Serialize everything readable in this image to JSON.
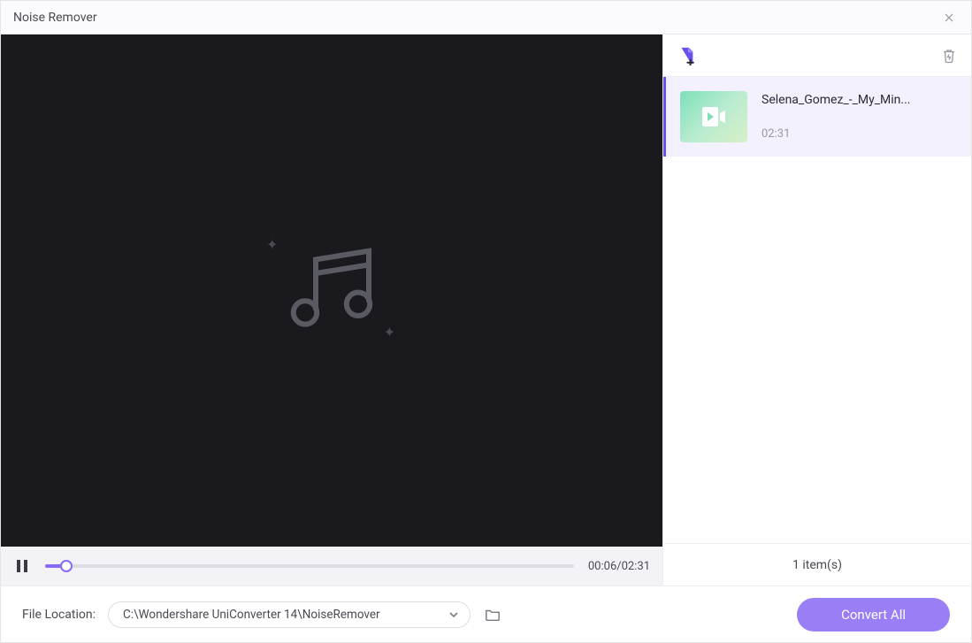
{
  "window": {
    "title": "Noise Remover"
  },
  "player": {
    "current_time": "00:06",
    "total_time": "02:31",
    "progress_percent": 4
  },
  "queue": {
    "items": [
      {
        "name": "Selena_Gomez_-_My_Min...",
        "duration": "02:31"
      }
    ],
    "count_label": "1 item(s)"
  },
  "footer": {
    "file_location_label": "File Location:",
    "file_location_value": "C:\\Wondershare UniConverter 14\\NoiseRemover",
    "convert_label": "Convert All"
  }
}
